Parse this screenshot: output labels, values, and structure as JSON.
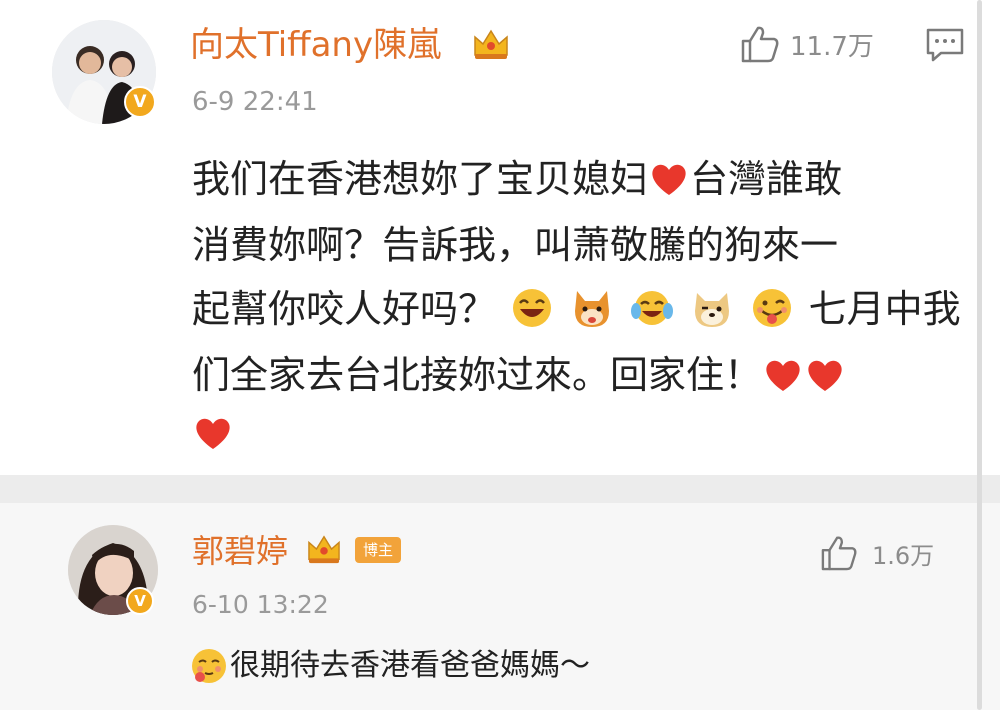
{
  "comments": [
    {
      "username": "向太Tiffany陳嵐",
      "timestamp": "6-9 22:41",
      "likes": "11.7万",
      "avatar_badge": "V",
      "text_lines": [
        "我们在香港想妳了宝贝媳妇",
        "台灣誰敢",
        "消費妳啊？告訴我，叫萧敬騰的狗來一",
        "起幫你咬人好吗？",
        "七月中我",
        "们全家去台北接妳过來。回家住！"
      ]
    },
    {
      "username": "郭碧婷",
      "badge": "博主",
      "timestamp": "6-10 13:22",
      "likes": "1.6万",
      "avatar_badge": "V",
      "text": "很期待去香港看爸爸媽媽～"
    }
  ],
  "icons": {
    "like": "thumb-up-icon",
    "reply": "comment-icon",
    "crown": "crown-icon",
    "heart": "heart-icon"
  },
  "colors": {
    "username": "#e0712b",
    "timestamp": "#9a9a9a",
    "badge": "#f2a33a",
    "heart": "#e8372c"
  }
}
